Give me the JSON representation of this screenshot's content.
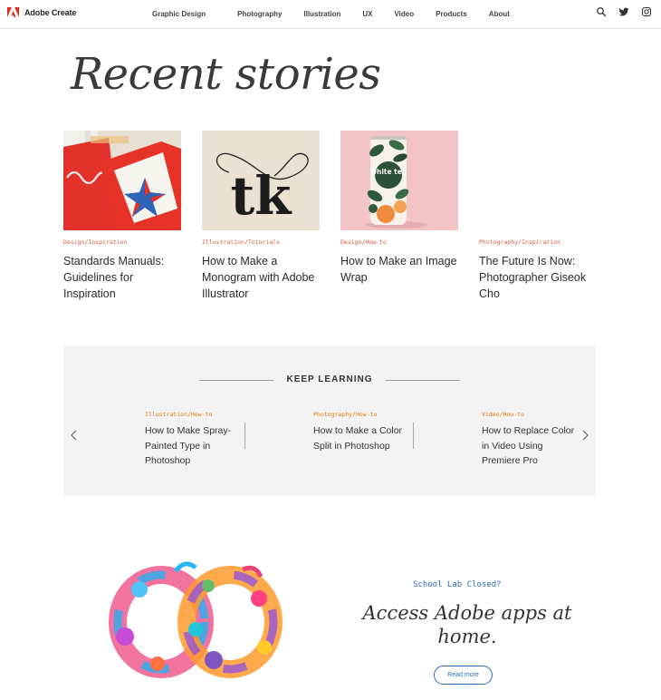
{
  "brand": {
    "name": "Adobe Create",
    "color": "#e1251b"
  },
  "nav": {
    "links": [
      "Graphic Design",
      "Photography",
      "Illustration",
      "UX",
      "Video",
      "Products",
      "About"
    ],
    "tools": [
      "search-icon",
      "twitter-icon",
      "instagram-icon"
    ]
  },
  "page_title": "Recent stories",
  "stories": [
    {
      "category": "Design/Inspiration",
      "title": "Standards Manuals: Guidelines for Inspiration"
    },
    {
      "category": "Illustration/Tutorials",
      "title": "How to Make a Monogram with Adobe Illustrator",
      "thumb_text": "tk"
    },
    {
      "category": "Design/How-to",
      "title": "How to Make an Image Wrap",
      "thumb_text": "white tea"
    },
    {
      "category": "Photography/Inspiration",
      "title": "The Future Is Now: Photographer Giseok Cho"
    }
  ],
  "keep_learning": {
    "heading": "KEEP LEARNING",
    "items": [
      {
        "category": "Illustration/How-to",
        "title": "How to Make Spray-Painted Type in Photoshop"
      },
      {
        "category": "Photography/How-to",
        "title": "How to Make a Color Split in Photoshop"
      },
      {
        "category": "Video/How-to",
        "title": "How to Replace Color in Video Using Premiere Pro"
      }
    ],
    "prev_icon": "chevron-left-icon",
    "next_icon": "chevron-right-icon"
  },
  "promo": {
    "eyebrow": "School Lab Closed?",
    "title": "Access Adobe apps at home.",
    "button": "Read more"
  },
  "colors": {
    "category_red": "#e05a3a",
    "category_orange": "#e07a12",
    "link_blue": "#2d6cc0",
    "panel_gray": "#f3f3f3"
  }
}
